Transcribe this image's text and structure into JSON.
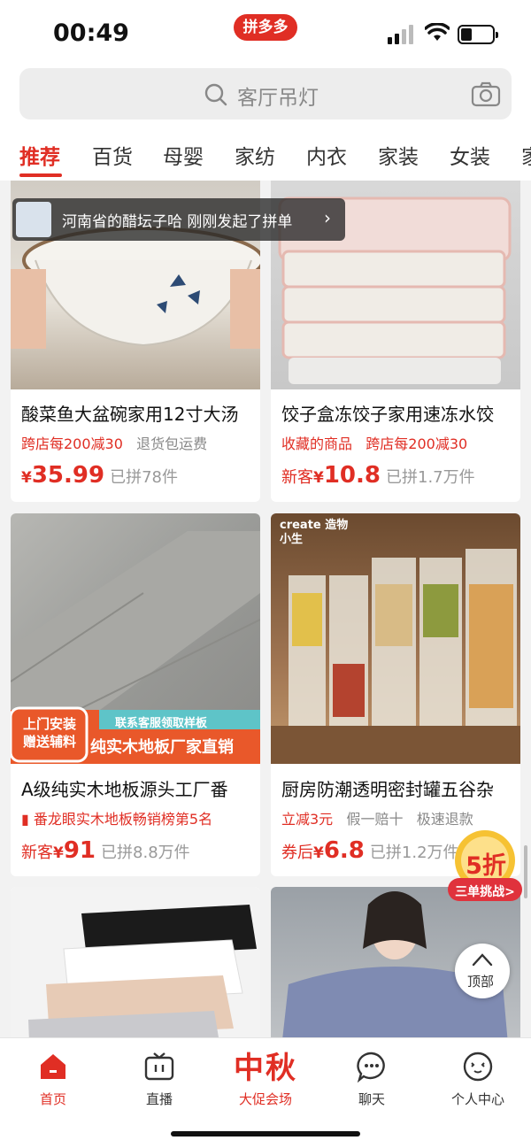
{
  "status_bar": {
    "time": "00:49",
    "brand": "拼多多"
  },
  "search": {
    "placeholder": "客厅吊灯"
  },
  "tabs": [
    "推荐",
    "百货",
    "母婴",
    "家纺",
    "内衣",
    "家装",
    "女装",
    "家"
  ],
  "notice": {
    "text": "河南省的醋坛子哈 刚刚发起了拼单",
    "arrow": "›"
  },
  "products": [
    {
      "title": "酸菜鱼大盆碗家用12寸大汤",
      "tags": [
        {
          "text": "跨店每200减30",
          "style": "red"
        },
        {
          "text": "退货包运费",
          "style": "gray"
        }
      ],
      "price_prefix": "",
      "price": "35.99",
      "sold": "已拼78件"
    },
    {
      "title": "饺子盒冻饺子家用速冻水饺",
      "tags": [
        {
          "text": "收藏的商品",
          "style": "red"
        },
        {
          "text": "跨店每200减30",
          "style": "red"
        }
      ],
      "price_prefix": "新客",
      "price": "10.8",
      "sold": "已拼1.7万件"
    },
    {
      "title": "A级纯实木地板源头工厂番",
      "tags": [
        {
          "text": "番龙眼实木地板畅销榜第5名",
          "style": "red"
        }
      ],
      "price_prefix": "新客",
      "price": "91",
      "sold": "已拼8.8万件",
      "image_banner": {
        "left": "上门安装 赠送辅料",
        "top": "联系客服领取样板",
        "main": "纯实木地板厂家直销"
      }
    },
    {
      "title": "厨房防潮透明密封罐五谷杂",
      "tags": [
        {
          "text": "立减3元",
          "style": "red"
        },
        {
          "text": "假一赔十",
          "style": "gray"
        },
        {
          "text": "极速退款",
          "style": "gray"
        }
      ],
      "price_prefix": "券后",
      "price": "6.8",
      "sold": "已拼1.2万件",
      "image_brand": "create 造物小生"
    },
    {
      "title": "",
      "tags": [],
      "price_prefix": "",
      "price": "",
      "sold": ""
    },
    {
      "title": "",
      "tags": [],
      "price_prefix": "",
      "price": "",
      "sold": ""
    }
  ],
  "currency": "¥",
  "promo_badge": {
    "discount": "5折",
    "caption": "三单挑战>"
  },
  "back_to_top": "顶部",
  "bottom_nav": [
    {
      "label": "首页",
      "icon": "home-icon",
      "active": true
    },
    {
      "label": "直播",
      "icon": "tv-icon",
      "active": false
    },
    {
      "label": "大促会场",
      "icon": "festival-text",
      "festival": "中秋",
      "active": false
    },
    {
      "label": "聊天",
      "icon": "chat-icon",
      "active": false
    },
    {
      "label": "个人中心",
      "icon": "profile-icon",
      "active": false
    }
  ],
  "colors": {
    "accent": "#e02e24",
    "muted": "#888888"
  }
}
